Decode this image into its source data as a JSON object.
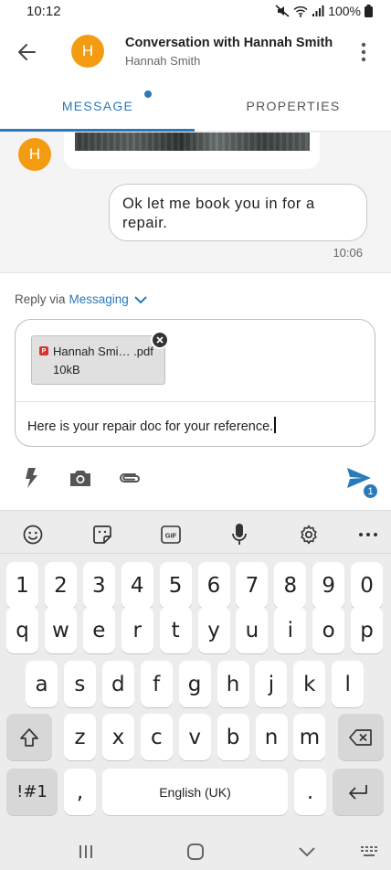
{
  "status_bar": {
    "time": "10:12",
    "battery": "100%"
  },
  "header": {
    "title": "Conversation with Hannah Smith",
    "subtitle": "Hannah Smith",
    "avatar_initial": "H"
  },
  "tabs": [
    {
      "label": "MESSAGE",
      "active": true
    },
    {
      "label": "PROPERTIES",
      "active": false
    }
  ],
  "conversation": {
    "contact_avatar_initial": "H",
    "outgoing_message": "Ok let me book you in for a repair.",
    "outgoing_time": "10:06"
  },
  "composer": {
    "reply_via_label": "Reply via",
    "reply_channel": "Messaging",
    "attachment": {
      "name": "Hannah Smi… .pdf",
      "size": "10kB",
      "type_badge": "P"
    },
    "message_text": "Here is your repair doc for your reference.",
    "send_badge_count": "1"
  },
  "keyboard": {
    "toolbar": [
      "emoji-icon",
      "sticker-icon",
      "gif-icon",
      "mic-icon",
      "settings-icon",
      "more-icon"
    ],
    "rows": [
      [
        "1",
        "2",
        "3",
        "4",
        "5",
        "6",
        "7",
        "8",
        "9",
        "0"
      ],
      [
        "q",
        "w",
        "e",
        "r",
        "t",
        "y",
        "u",
        "i",
        "o",
        "p"
      ],
      [
        "a",
        "s",
        "d",
        "f",
        "g",
        "h",
        "j",
        "k",
        "l"
      ],
      [
        "z",
        "x",
        "c",
        "v",
        "b",
        "n",
        "m"
      ]
    ],
    "symbols_label": "!#1",
    "comma": ",",
    "space_label": "English (UK)",
    "period": ".",
    "gif_label": "GIF"
  },
  "colors": {
    "accent": "#2a7ab9",
    "avatar": "#f39c12"
  }
}
